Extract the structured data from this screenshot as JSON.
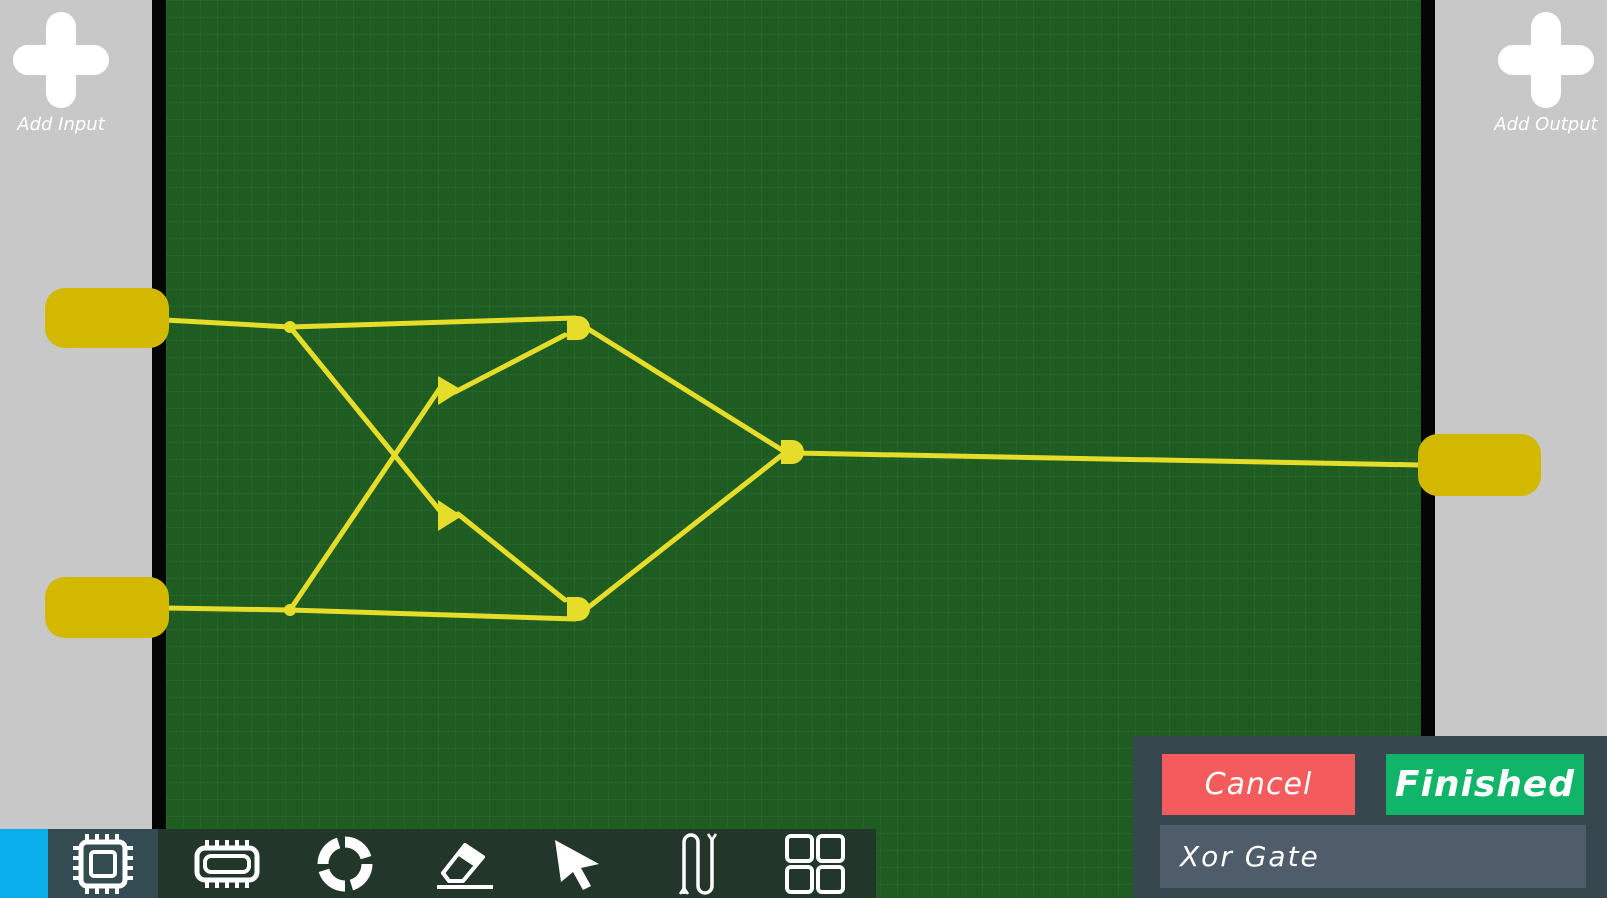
{
  "colors": {
    "board": "#1f5c22",
    "wire": "#e6dc2a",
    "pin": "#d2b800",
    "sidebar": "#c8c8c8",
    "toolbar": "#22372a",
    "accent": "#0aaeea",
    "cancel": "#f45b5c",
    "finished": "#11b56a",
    "panel": "#36474d",
    "name_field": "#4e5d69"
  },
  "left_panel": {
    "add_label": "Add Input",
    "icon": "plus-icon"
  },
  "right_panel": {
    "add_label": "Add Output",
    "icon": "plus-icon"
  },
  "toolbar": {
    "tools": [
      {
        "name": "chip",
        "icon": "chip-icon",
        "active": true
      },
      {
        "name": "wide-chip",
        "icon": "wide-chip-icon",
        "active": false
      },
      {
        "name": "ring",
        "icon": "ring-icon",
        "active": false
      },
      {
        "name": "eraser",
        "icon": "eraser-icon",
        "active": false
      },
      {
        "name": "select",
        "icon": "cursor-icon",
        "active": false
      },
      {
        "name": "wire",
        "icon": "wire-icon",
        "active": false
      },
      {
        "name": "grid",
        "icon": "grid-icon",
        "active": false
      }
    ]
  },
  "actions": {
    "cancel_label": "Cancel",
    "finished_label": "Finished",
    "chip_name_value": "Xor Gate"
  }
}
